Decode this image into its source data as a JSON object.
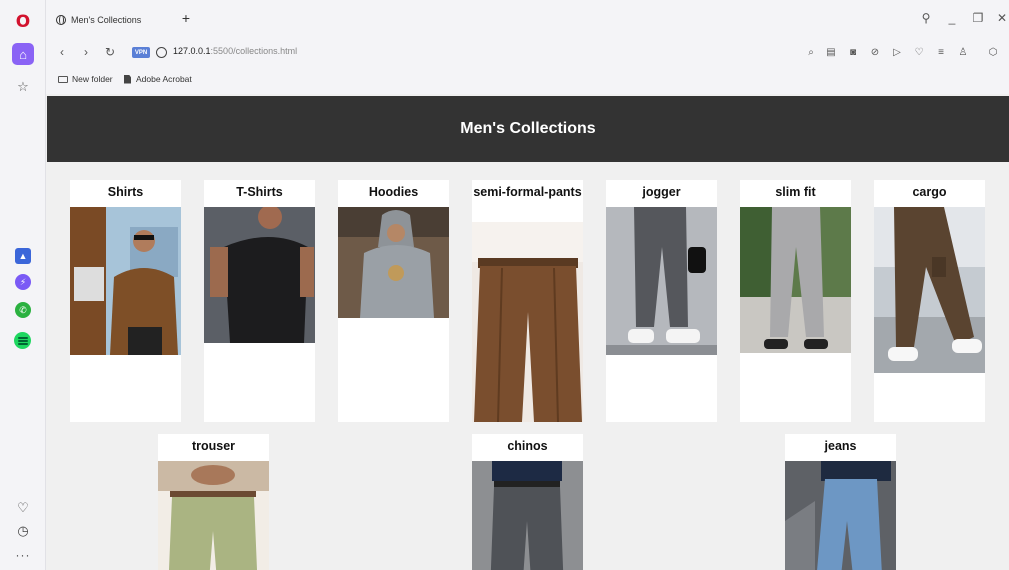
{
  "browser": {
    "tab_title": "Men's Collections",
    "new_tab_glyph": "+",
    "url_host": "127.0.0.1",
    "url_rest": ":5500/collections.html",
    "vpn_label": "VPN",
    "bookmarks": [
      {
        "label": "New folder",
        "icon": "folder-icon"
      },
      {
        "label": "Adobe Acrobat",
        "icon": "document-icon"
      }
    ],
    "accent_color": "#8a63f5"
  },
  "page": {
    "header_title": "Men's Collections",
    "header_bg": "#333333",
    "background": "#f0f0f0"
  },
  "collections_row1": [
    {
      "title": "Shirts"
    },
    {
      "title": "T-Shirts"
    },
    {
      "title": "Hoodies"
    },
    {
      "title": "semi-formal-pants"
    },
    {
      "title": "jogger"
    },
    {
      "title": "slim fit"
    },
    {
      "title": "cargo"
    }
  ],
  "collections_row2": [
    {
      "title": "trouser"
    },
    {
      "title": "chinos"
    },
    {
      "title": "jeans"
    }
  ]
}
